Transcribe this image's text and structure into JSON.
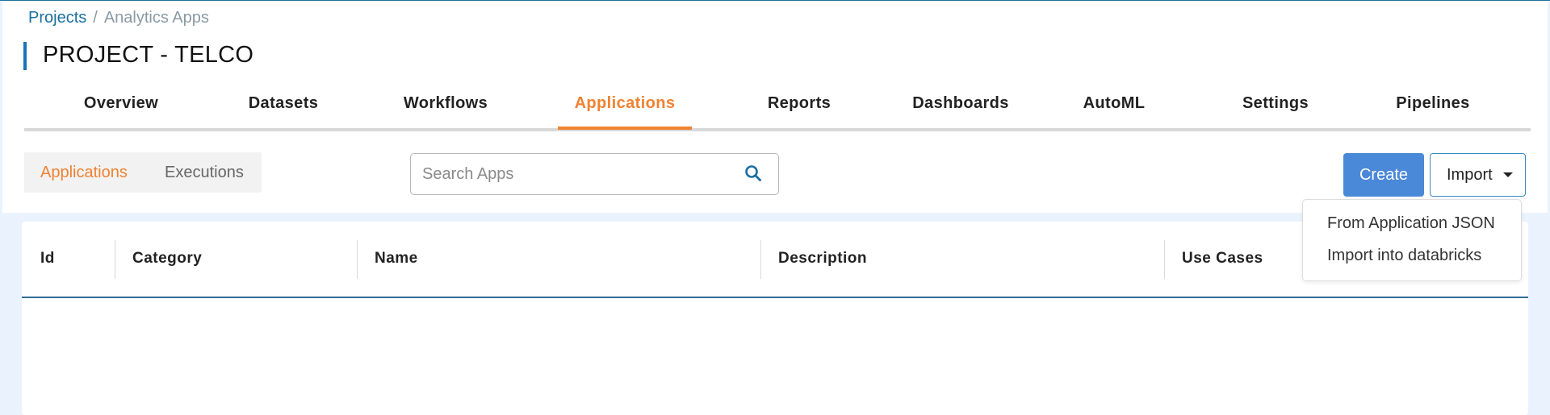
{
  "breadcrumb": {
    "root": "Projects",
    "separator": "/",
    "current": "Analytics Apps"
  },
  "page": {
    "title": "PROJECT - TELCO"
  },
  "tabs": [
    {
      "label": "Overview"
    },
    {
      "label": "Datasets"
    },
    {
      "label": "Workflows"
    },
    {
      "label": "Applications",
      "active": true
    },
    {
      "label": "Reports"
    },
    {
      "label": "Dashboards"
    },
    {
      "label": "AutoML"
    },
    {
      "label": "Settings"
    },
    {
      "label": "Pipelines"
    }
  ],
  "subtabs": [
    {
      "label": "Applications",
      "active": true
    },
    {
      "label": "Executions"
    }
  ],
  "search": {
    "placeholder": "Search Apps",
    "value": "",
    "icon": "search-icon"
  },
  "actions": {
    "create_label": "Create",
    "import_label": "Import"
  },
  "import_menu": {
    "items": [
      "From Application JSON",
      "Import into databricks"
    ]
  },
  "table": {
    "columns": [
      "Id",
      "Category",
      "Name",
      "Description",
      "Use Cases"
    ],
    "rows": []
  },
  "colors": {
    "accent": "#f08232",
    "primary": "#4a88d8",
    "link": "#1a6fa0",
    "title_bar": "#1a73b8"
  }
}
